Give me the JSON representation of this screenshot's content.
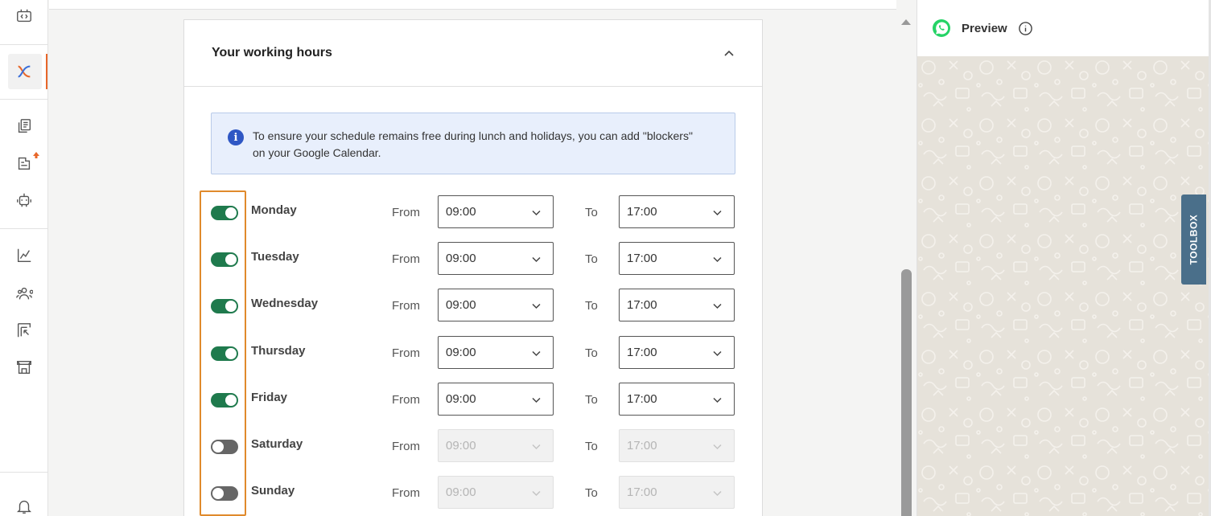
{
  "card": {
    "title": "Your working hours",
    "info": "To ensure your schedule remains free during lunch and holidays, you can add \"blockers\" on your Google Calendar."
  },
  "labels": {
    "from": "From",
    "to": "To"
  },
  "days": [
    {
      "name": "Monday",
      "enabled": true,
      "from": "09:00",
      "to": "17:00"
    },
    {
      "name": "Tuesday",
      "enabled": true,
      "from": "09:00",
      "to": "17:00"
    },
    {
      "name": "Wednesday",
      "enabled": true,
      "from": "09:00",
      "to": "17:00"
    },
    {
      "name": "Thursday",
      "enabled": true,
      "from": "09:00",
      "to": "17:00"
    },
    {
      "name": "Friday",
      "enabled": true,
      "from": "09:00",
      "to": "17:00"
    },
    {
      "name": "Saturday",
      "enabled": false,
      "from": "09:00",
      "to": "17:00"
    },
    {
      "name": "Sunday",
      "enabled": false,
      "from": "09:00",
      "to": "17:00"
    }
  ],
  "preview": {
    "title": "Preview"
  },
  "toolbox": {
    "label": "TOOLBOX"
  },
  "sidebar": {
    "icons": [
      "code-icon",
      "brand-x-icon",
      "documents-icon",
      "inbox-upload-icon",
      "bot-icon",
      "analytics-icon",
      "contacts-icon",
      "forms-icon",
      "store-icon",
      "bell-icon"
    ]
  },
  "colors": {
    "accent": "#e8672a",
    "toggle_on": "#1f7a4d",
    "highlight": "#e08a2c",
    "info_bg": "#e8effc",
    "toolbox": "#4a6f8a"
  }
}
